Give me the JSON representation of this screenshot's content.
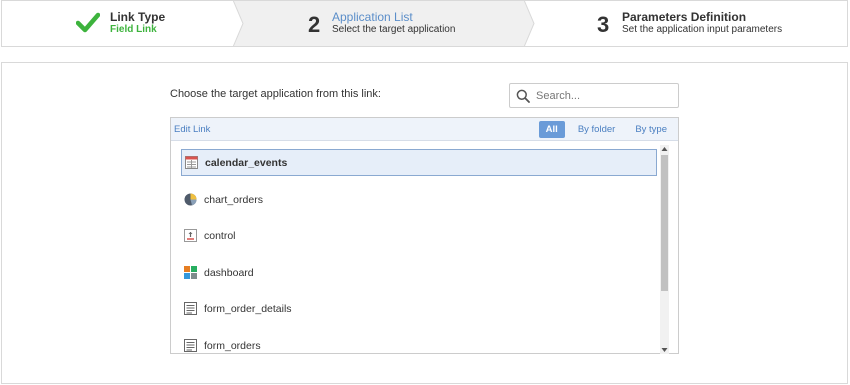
{
  "wizard": {
    "steps": [
      {
        "number": "",
        "title": "Link Type",
        "subtitle": "Field Link",
        "state": "done"
      },
      {
        "number": "2",
        "title": "Application List",
        "subtitle": "Select the target application",
        "state": "active"
      },
      {
        "number": "3",
        "title": "Parameters Definition",
        "subtitle": "Set the application input parameters",
        "state": "pending"
      }
    ]
  },
  "panel": {
    "choose_label": "Choose the target application from this link:",
    "search": {
      "placeholder": "Search...",
      "value": ""
    },
    "toolbar": {
      "edit_link": "Edit Link",
      "filters": [
        {
          "label": "All",
          "active": true
        },
        {
          "label": "By folder",
          "active": false
        },
        {
          "label": "By type",
          "active": false
        }
      ]
    },
    "applications": [
      {
        "name": "calendar_events",
        "icon": "calendar-icon",
        "selected": true
      },
      {
        "name": "chart_orders",
        "icon": "pie-chart-icon",
        "selected": false
      },
      {
        "name": "control",
        "icon": "control-icon",
        "selected": false
      },
      {
        "name": "dashboard",
        "icon": "dashboard-icon",
        "selected": false
      },
      {
        "name": "form_order_details",
        "icon": "form-icon",
        "selected": false
      },
      {
        "name": "form_orders",
        "icon": "form-icon",
        "selected": false
      }
    ]
  },
  "colors": {
    "accent": "#5b8ec9",
    "done": "#3db33d",
    "filter_active": "#6a9bd8"
  }
}
